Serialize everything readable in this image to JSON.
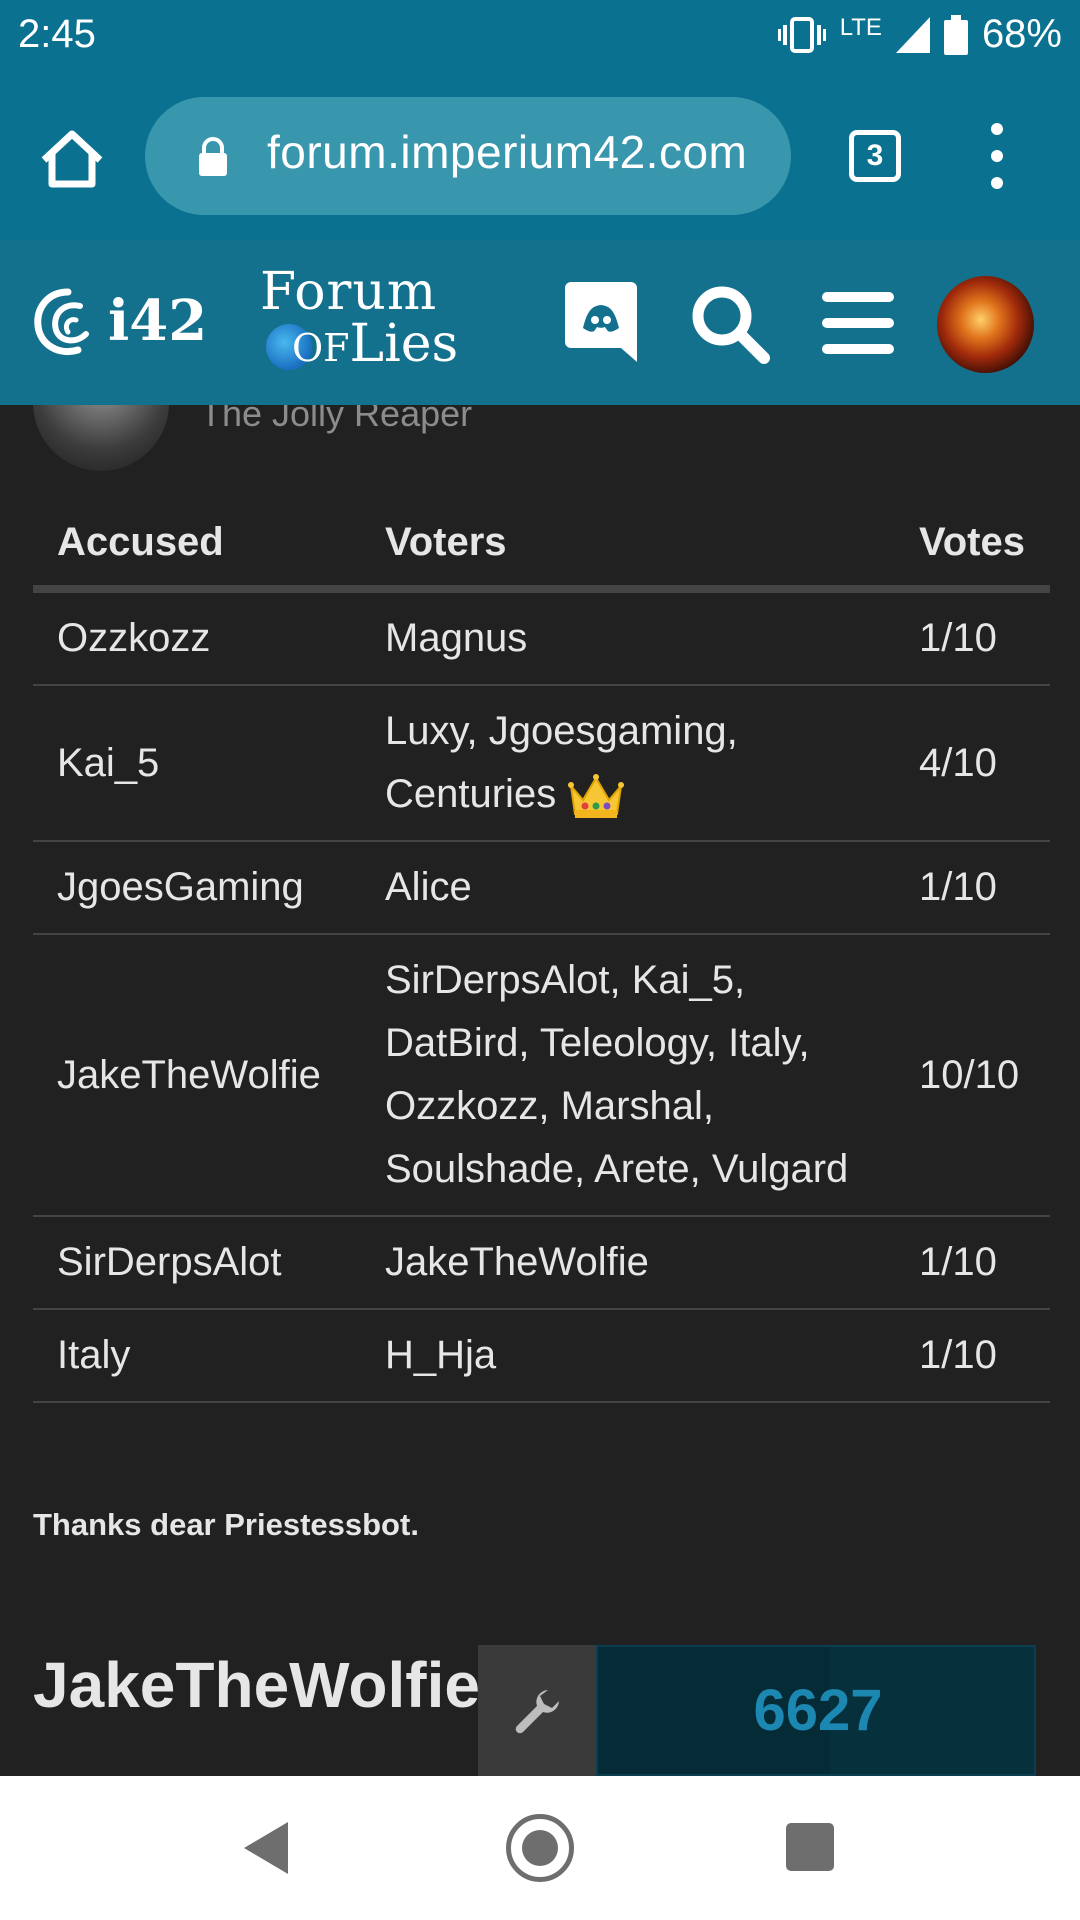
{
  "status_bar": {
    "time": "2:45",
    "network": "LTE",
    "battery": "68%"
  },
  "browser": {
    "url": "forum.imperium42.com",
    "tab_count": "3"
  },
  "site_header": {
    "logo_i42": "i42",
    "logo_forum_line1": "Forum",
    "logo_forum_of": "OF",
    "logo_forum_lies": "Lies"
  },
  "post": {
    "user_title": "The Jolly Reaper"
  },
  "vote_table": {
    "headers": [
      "Accused",
      "Voters",
      "Votes"
    ],
    "rows": [
      {
        "accused": "Ozzkozz",
        "voters": "Magnus",
        "votes": "1/10"
      },
      {
        "accused": "Kai_5",
        "voters": "Luxy, Jgoesgaming, Centuries",
        "votes": "4/10"
      },
      {
        "accused": "JgoesGaming",
        "voters": "Alice",
        "votes": "1/10"
      },
      {
        "accused": "JakeTheWolfie",
        "voters": "SirDerpsAlot, Kai_5, DatBird, Teleology, Italy, Ozzkozz, Marshal, Soulshade, Arete, Vulgard",
        "votes": "10/10"
      },
      {
        "accused": "SirDerpsAlot",
        "voters": "JakeTheWolfie",
        "votes": "1/10"
      },
      {
        "accused": "Italy",
        "voters": "H_Hja",
        "votes": "1/10"
      }
    ]
  },
  "thanks_text": "Thanks dear Priestessbot.",
  "big_heading": "JakeTheWolfie lynched. They",
  "overlay": {
    "counter": "6627"
  }
}
